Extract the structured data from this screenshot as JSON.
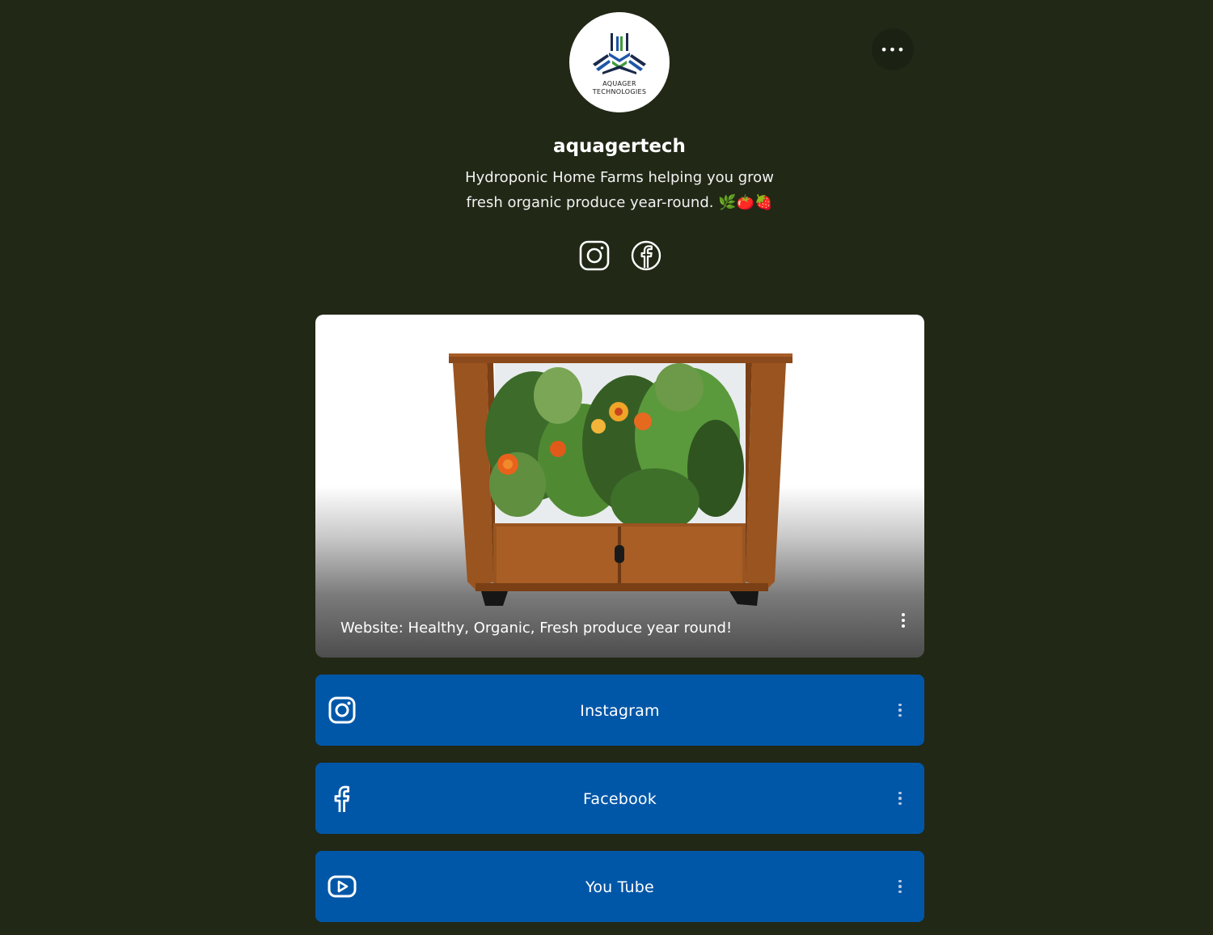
{
  "profile": {
    "logo_line1": "AQUAGER",
    "logo_line2": "TECHNOLOGIES",
    "username": "aquagertech",
    "bio": "Hydroponic Home Farms helping you grow fresh organic produce year-round. 🌿🍅🍓",
    "menu_icon": "ellipsis-icon",
    "menu_glyph": "•••"
  },
  "social_icons": [
    "instagram-icon",
    "facebook-icon"
  ],
  "featured_link": {
    "title": "Website: Healthy, Organic, Fresh produce year round!",
    "image": "hydroponic-planter-cabinet"
  },
  "links": [
    {
      "label": "Instagram",
      "icon": "instagram-icon"
    },
    {
      "label": "Facebook",
      "icon": "facebook-icon"
    },
    {
      "label": "You Tube",
      "icon": "youtube-icon"
    }
  ],
  "colors": {
    "background": "#212816",
    "button": "#0057a8",
    "text": "#ffffff",
    "logo_blue": "#1f56a8",
    "logo_green": "#3f9a3a",
    "logo_dark": "#1a2a4a"
  }
}
